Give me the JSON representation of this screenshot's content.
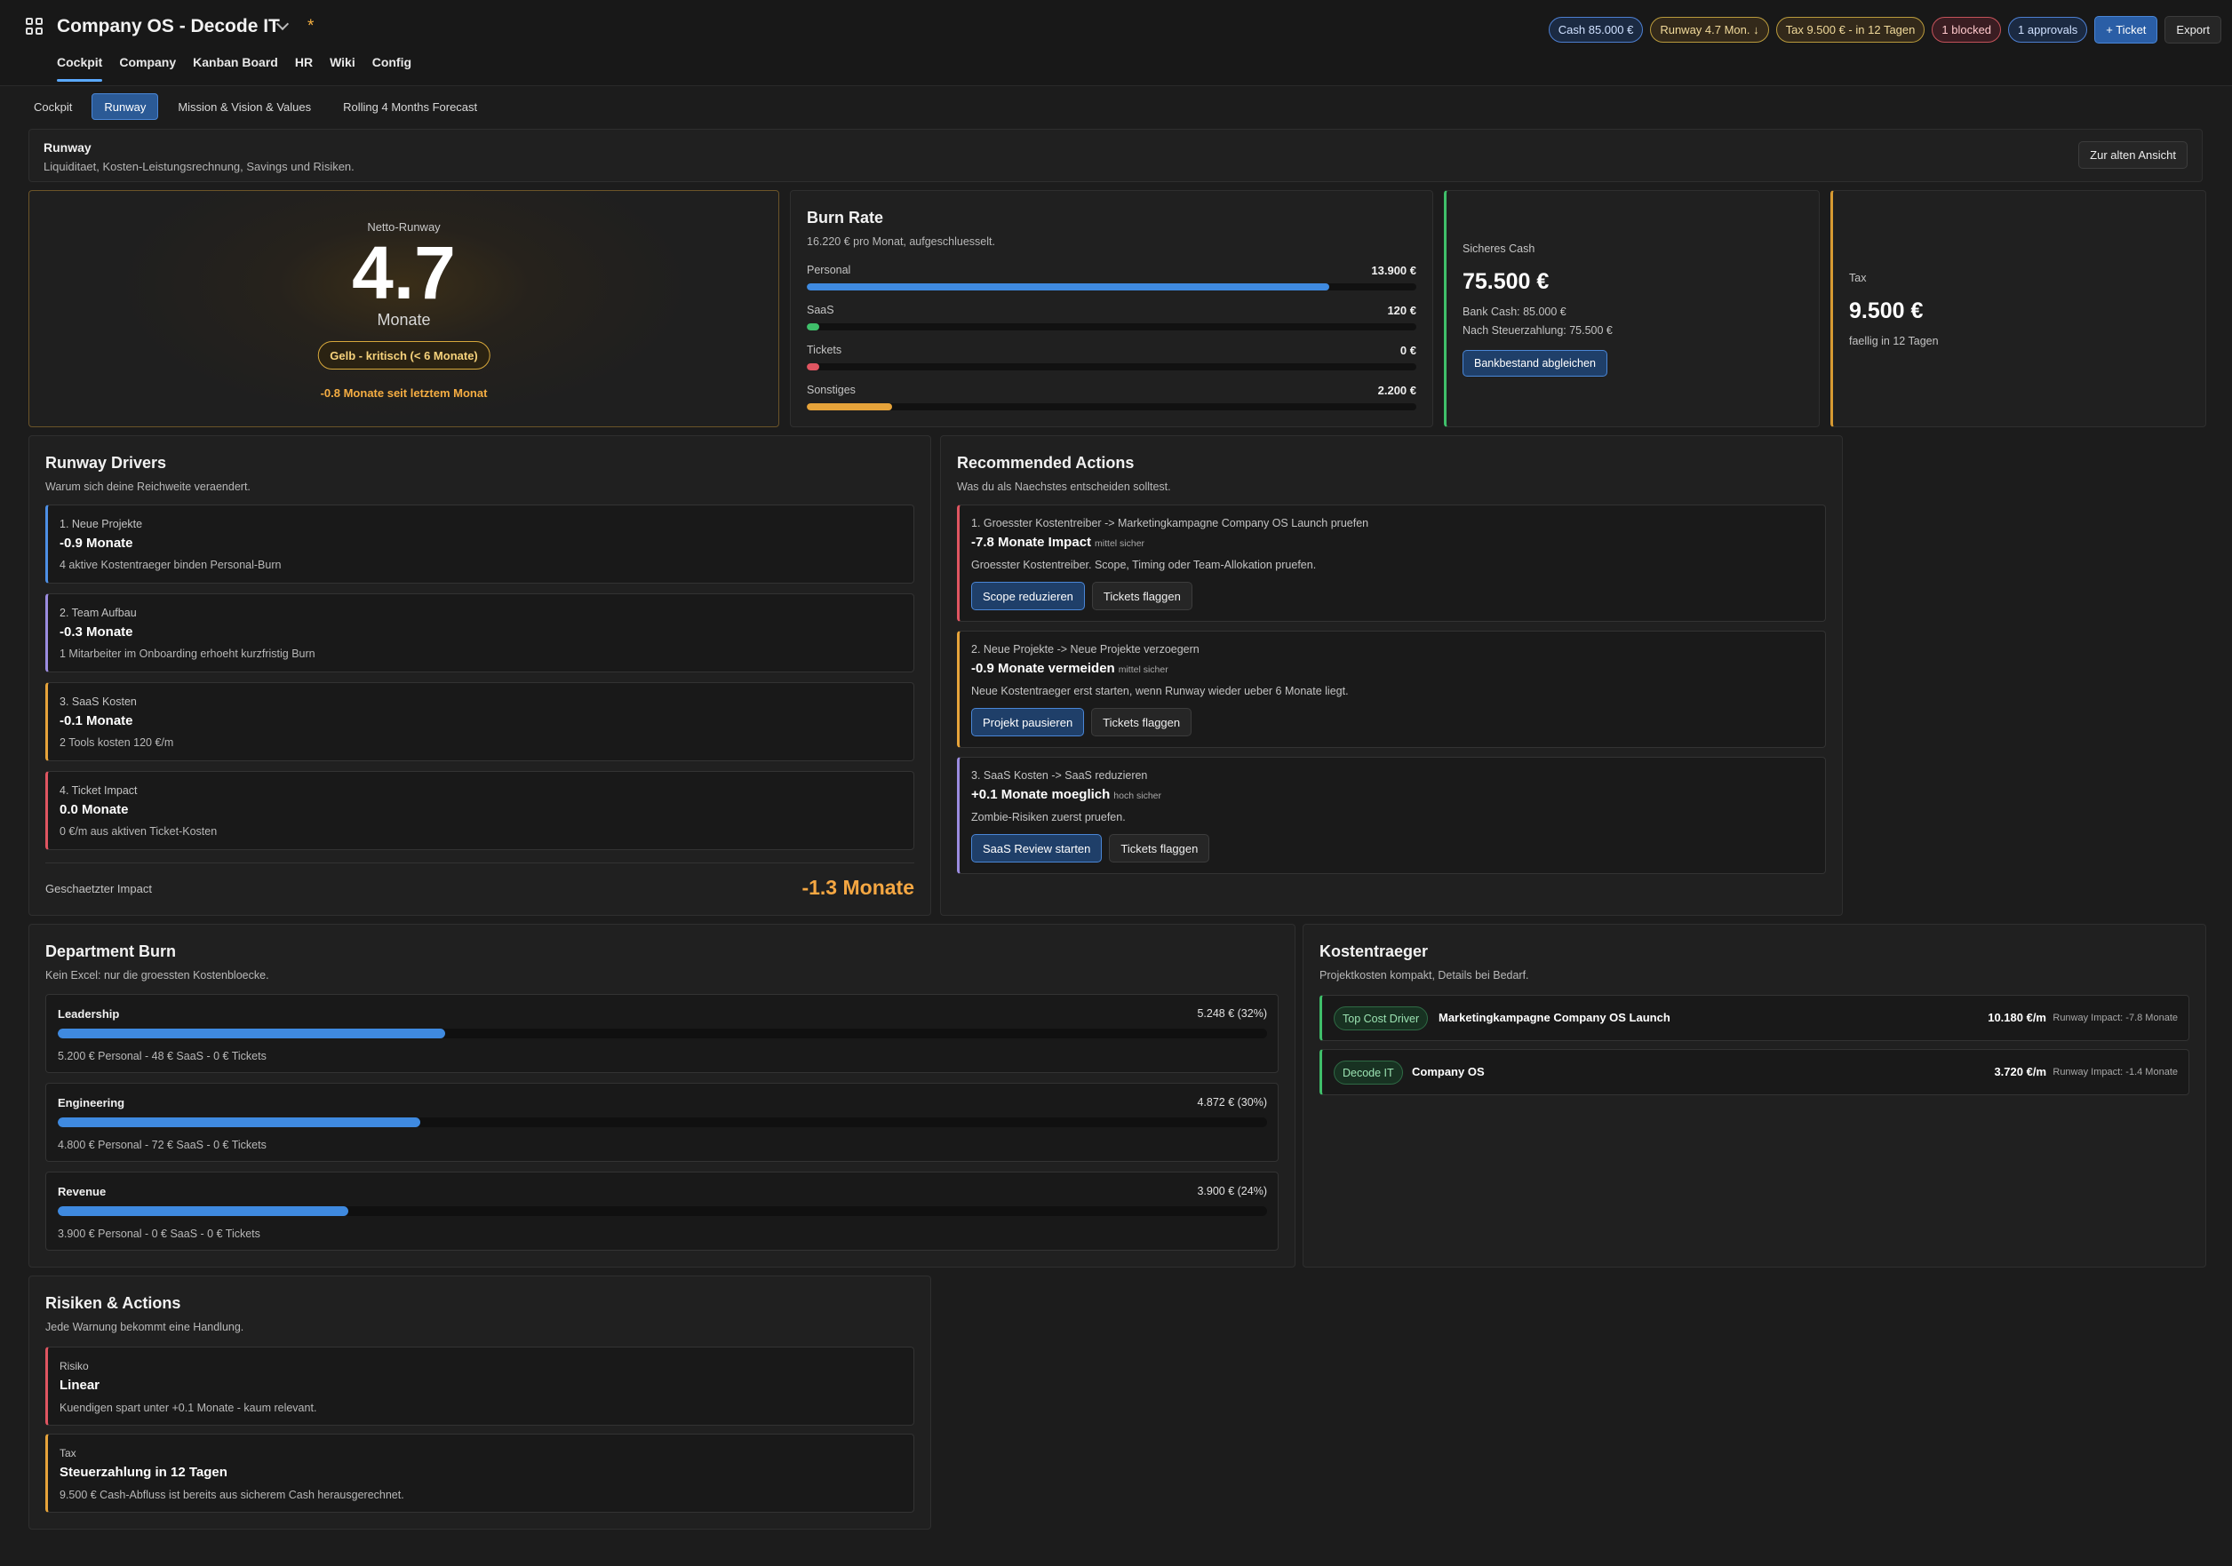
{
  "app": {
    "title": "Company OS - Decode IT",
    "star": "*"
  },
  "mainnav": [
    "Cockpit",
    "Company",
    "Kanban Board",
    "HR",
    "Wiki",
    "Config"
  ],
  "top_pills": {
    "cash": "Cash 85.000 €",
    "runway": "Runway 4.7 Mon. ↓",
    "tax": "Tax 9.500 € - in 12 Tagen",
    "blocked": "1 blocked",
    "approvals": "1 approvals",
    "ticket_button": "+ Ticket",
    "export_button": "Export"
  },
  "subtabs": [
    "Cockpit",
    "Runway",
    "Mission & Vision & Values",
    "Rolling 4 Months Forecast"
  ],
  "header": {
    "title": "Runway",
    "subtitle": "Liquiditaet, Kosten-Leistungsrechnung, Savings und Risiken.",
    "old_view_button": "Zur alten Ansicht"
  },
  "runway": {
    "label": "Netto-Runway",
    "value": "4.7",
    "unit": "Monate",
    "badge": "Gelb - kritisch (< 6 Monate)",
    "delta": "-0.8 Monate seit letztem Monat"
  },
  "burn": {
    "title": "Burn Rate",
    "subtitle": "16.220 € pro Monat, aufgeschluesselt.",
    "items": [
      {
        "label": "Personal",
        "value": "13.900 €",
        "share": 0.857,
        "color": "#3f8ae0"
      },
      {
        "label": "SaaS",
        "value": "120 €",
        "share": 0.02,
        "color": "#3fbf6a"
      },
      {
        "label": "Tickets",
        "value": "0 €",
        "share": 0.02,
        "color": "#e05561"
      },
      {
        "label": "Sonstiges",
        "value": "2.200 €",
        "share": 0.14,
        "color": "#e6a33a"
      }
    ]
  },
  "cash": {
    "label": "Sicheres Cash",
    "value": "75.500 €",
    "bank": "Bank Cash: 85.000 €",
    "after_tax": "Nach Steuerzahlung: 75.500 €",
    "button": "Bankbestand abgleichen"
  },
  "tax": {
    "label": "Tax",
    "value": "9.500 €",
    "due": "faellig in 12 Tagen"
  },
  "drivers": {
    "title": "Runway Drivers",
    "subtitle": "Warum sich deine Reichweite veraendert.",
    "items": [
      {
        "label": "1. Neue Projekte",
        "value": "-0.9 Monate",
        "desc": "4 aktive Kostentraeger binden Personal-Burn",
        "color": "#4d8fe6"
      },
      {
        "label": "2. Team Aufbau",
        "value": "-0.3 Monate",
        "desc": "1 Mitarbeiter im Onboarding erhoeht kurzfristig Burn",
        "color": "#9b8ce0"
      },
      {
        "label": "3. SaaS Kosten",
        "value": "-0.1 Monate",
        "desc": "2 Tools kosten 120 €/m",
        "color": "#e6a33a"
      },
      {
        "label": "4. Ticket Impact",
        "value": "0.0 Monate",
        "desc": "0 €/m aus aktiven Ticket-Kosten",
        "color": "#e05561"
      }
    ],
    "impact_label": "Geschaetzter Impact",
    "impact_value": "-1.3 Monate"
  },
  "actions": {
    "title": "Recommended Actions",
    "subtitle": "Was du als Naechstes entscheiden solltest.",
    "items": [
      {
        "label": "1. Groesster Kostentreiber -> Marketingkampagne Company OS Launch pruefen",
        "value": "-7.8 Monate Impact",
        "certainty": "mittel sicher",
        "desc": "Groesster Kostentreiber. Scope, Timing oder Team-Allokation pruefen.",
        "primary": "Scope reduzieren",
        "secondary": "Tickets flaggen",
        "color": "#e05561"
      },
      {
        "label": "2. Neue Projekte -> Neue Projekte verzoegern",
        "value": "-0.9 Monate vermeiden",
        "certainty": "mittel sicher",
        "desc": "Neue Kostentraeger erst starten, wenn Runway wieder ueber 6 Monate liegt.",
        "primary": "Projekt pausieren",
        "secondary": "Tickets flaggen",
        "color": "#e6a33a"
      },
      {
        "label": "3. SaaS Kosten -> SaaS reduzieren",
        "value": "+0.1 Monate moeglich",
        "certainty": "hoch sicher",
        "desc": "Zombie-Risiken zuerst pruefen.",
        "primary": "SaaS Review starten",
        "secondary": "Tickets flaggen",
        "color": "#9b8ce0"
      }
    ]
  },
  "departments": {
    "title": "Department Burn",
    "subtitle": "Kein Excel: nur die groessten Kostenbloecke.",
    "items": [
      {
        "name": "Leadership",
        "value": "5.248 € (32%)",
        "share": 0.32,
        "detail": "5.200 € Personal - 48 € SaaS - 0 € Tickets"
      },
      {
        "name": "Engineering",
        "value": "4.872 € (30%)",
        "share": 0.3,
        "detail": "4.800 € Personal - 72 € SaaS - 0 € Tickets"
      },
      {
        "name": "Revenue",
        "value": "3.900 € (24%)",
        "share": 0.24,
        "detail": "3.900 € Personal - 0 € SaaS - 0 € Tickets"
      }
    ]
  },
  "kostentraeger": {
    "title": "Kostentraeger",
    "subtitle": "Projektkosten kompakt, Details bei Bedarf.",
    "items": [
      {
        "tag": "Top Cost Driver",
        "name": "Marketingkampagne Company OS Launch",
        "value": "10.180 €/m",
        "impact": "Runway Impact: -7.8 Monate"
      },
      {
        "tag": "Decode IT",
        "name": "Company OS",
        "value": "3.720 €/m",
        "impact": "Runway Impact: -1.4 Monate"
      }
    ]
  },
  "risks": {
    "title": "Risiken & Actions",
    "subtitle": "Jede Warnung bekommt eine Handlung.",
    "items": [
      {
        "label": "Risiko",
        "value": "Linear",
        "desc": "Kuendigen spart unter +0.1 Monate - kaum relevant.",
        "color": "#e05561"
      },
      {
        "label": "Tax",
        "value": "Steuerzahlung in 12 Tagen",
        "desc": "9.500 € Cash-Abfluss ist bereits aus sicherem Cash herausgerechnet.",
        "color": "#e6a33a"
      }
    ]
  }
}
